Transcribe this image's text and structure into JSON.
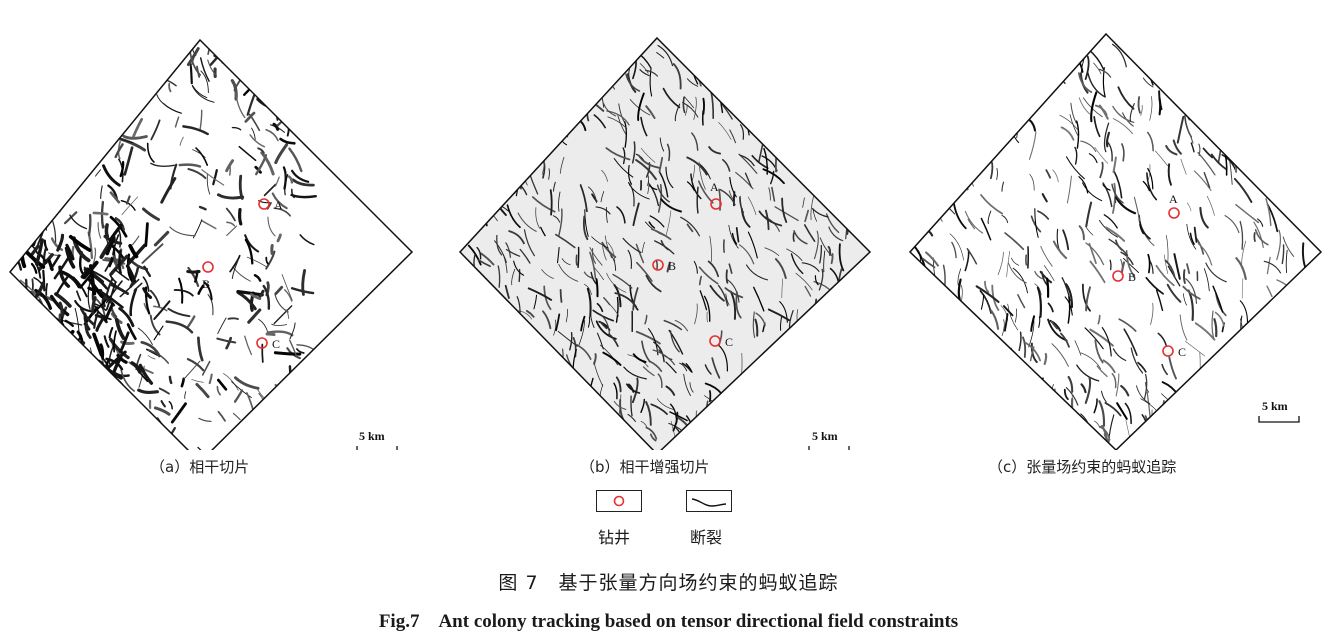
{
  "panels": [
    {
      "id": "a",
      "caption": "（a）相干切片",
      "wells": [
        "A",
        "B",
        "C"
      ],
      "scale": "5 km"
    },
    {
      "id": "b",
      "caption": "（b）相干增强切片",
      "wells": [
        "A",
        "B",
        "C"
      ],
      "scale": "5 km"
    },
    {
      "id": "c",
      "caption": "（c）张量场约束的蚂蚁追踪",
      "wells": [
        "A",
        "B",
        "C"
      ],
      "scale": "5 km"
    }
  ],
  "legend": {
    "well_label": "钻井",
    "fault_label": "断裂"
  },
  "figure": {
    "title_cn": "图 7　基于张量方向场约束的蚂蚁追踪",
    "title_en": "Fig.7　Ant colony tracking based on tensor directional field constraints"
  },
  "colors": {
    "well_marker": "#e53030",
    "fault": "#1a1a1a",
    "frame": "#111111"
  }
}
